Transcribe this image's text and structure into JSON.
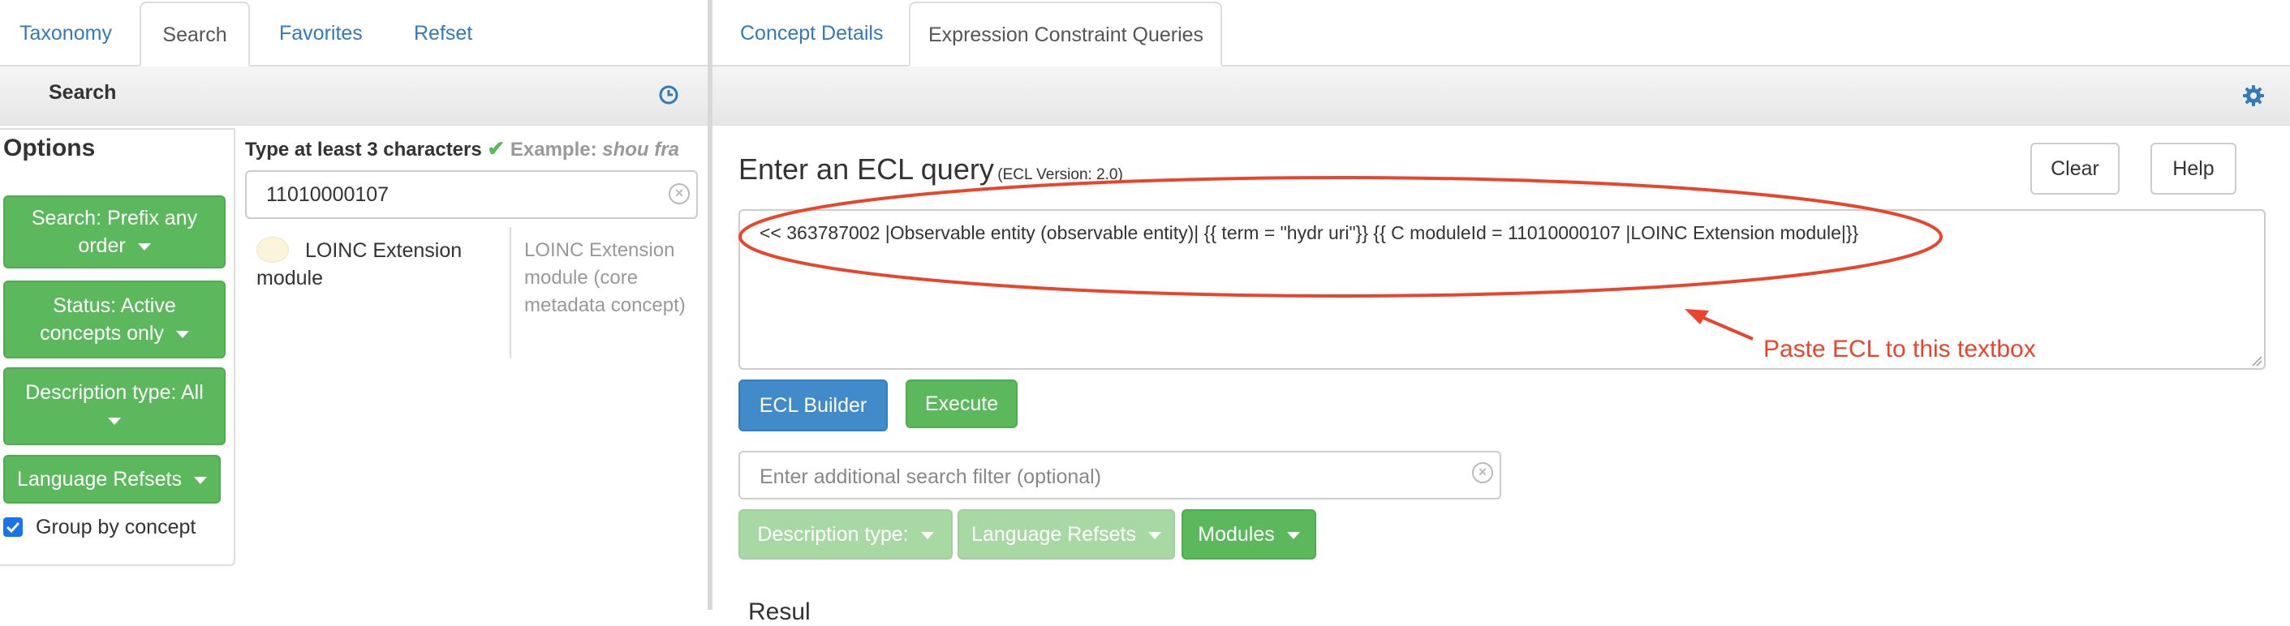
{
  "left_tabs": [
    {
      "label": "Taxonomy",
      "active": false
    },
    {
      "label": "Search",
      "active": true
    },
    {
      "label": "Favorites",
      "active": false
    },
    {
      "label": "Refset",
      "active": false
    }
  ],
  "right_tabs": [
    {
      "label": "Concept Details",
      "active": false
    },
    {
      "label": "Expression Constraint Queries",
      "active": true
    }
  ],
  "search_panel": {
    "title": "Search",
    "history_icon": "history-clock-icon"
  },
  "options": {
    "title": "Options",
    "buttons": [
      "Search: Prefix any order",
      "Status: Active concepts only",
      "Description type: All",
      "Language Refsets"
    ],
    "group_by_concept": {
      "label": "Group by concept",
      "checked": true
    }
  },
  "search_box": {
    "hint_prefix": "Type at least 3 characters",
    "hint_example_label": "Example:",
    "hint_example_value": "shou fra",
    "value": "11010000107"
  },
  "results": [
    {
      "term": "LOINC Extension module",
      "fsn": "LOINC Extension module (core metadata concept)"
    }
  ],
  "ecl": {
    "title": "Enter an ECL query",
    "version": "(ECL Version: 2.0)",
    "clear_label": "Clear",
    "help_label": "Help",
    "query": "<< 363787002 |Observable entity (observable entity)| {{ term = \"hydr uri\"}} {{ C moduleId = 11010000107 |LOINC Extension module|}}",
    "annotation": "Paste ECL to this textbox",
    "builder_label": "ECL Builder",
    "execute_label": "Execute",
    "filter_placeholder": "Enter additional search filter (optional)",
    "filter_value": "",
    "filters": [
      {
        "label": "Description type:",
        "enabled": false
      },
      {
        "label": "Language Refsets",
        "enabled": false
      },
      {
        "label": "Modules",
        "enabled": true
      }
    ],
    "results_heading_partial": "Resul"
  },
  "colors": {
    "link": "#337ab7",
    "green": "#5cb85c",
    "blue": "#428bca",
    "annotation_red": "#e8452c"
  }
}
